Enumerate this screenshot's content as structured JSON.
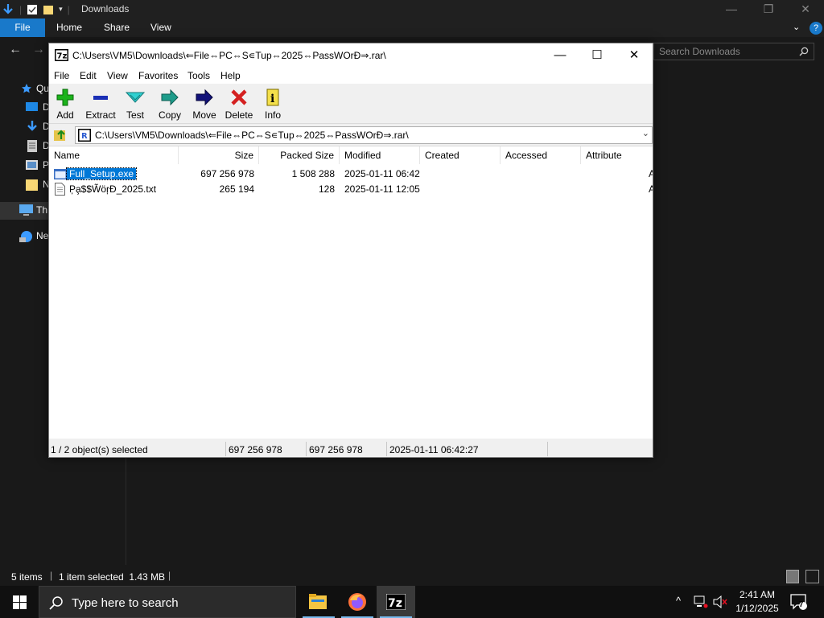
{
  "explorer": {
    "title": "Downloads",
    "tabs": {
      "file": "File",
      "home": "Home",
      "share": "Share",
      "view": "View"
    },
    "search_placeholder": "Search Downloads",
    "sidebar": [
      {
        "label": "Qu",
        "icon": "star-icon"
      },
      {
        "label": "D",
        "icon": "desktop-folder-icon"
      },
      {
        "label": "D",
        "icon": "downloads-folder-icon"
      },
      {
        "label": "D",
        "icon": "documents-folder-icon"
      },
      {
        "label": "P",
        "icon": "pictures-folder-icon"
      },
      {
        "label": "N",
        "icon": "folder-icon"
      },
      {
        "label": "Th",
        "icon": "this-pc-icon"
      },
      {
        "label": "Ne",
        "icon": "network-icon"
      }
    ],
    "status": {
      "items": "5 items",
      "selected": "1 item selected  1.43 MB"
    }
  },
  "zip": {
    "title": "C:\\Users\\VM5\\Downloads\\⇐File⇔PC⇔S∊Tup⇔2025⇔PassWOrÐ⇒.rar\\",
    "menu": [
      "File",
      "Edit",
      "View",
      "Favorites",
      "Tools",
      "Help"
    ],
    "toolbar": [
      {
        "label": "Add",
        "icon": "add-icon"
      },
      {
        "label": "Extract",
        "icon": "extract-icon"
      },
      {
        "label": "Test",
        "icon": "test-icon"
      },
      {
        "label": "Copy",
        "icon": "copy-icon"
      },
      {
        "label": "Move",
        "icon": "move-icon"
      },
      {
        "label": "Delete",
        "icon": "delete-icon"
      },
      {
        "label": "Info",
        "icon": "info-icon"
      }
    ],
    "address": "C:\\Users\\VM5\\Downloads\\⇐File⇔PC⇔S∊Tup⇔2025⇔PassWOrÐ⇒.rar\\",
    "columns": [
      "Name",
      "Size",
      "Packed Size",
      "Modified",
      "Created",
      "Accessed",
      "Attribute"
    ],
    "rows": [
      {
        "name": "Full_Setup.exe",
        "size": "697 256 978",
        "packed": "1 508 288",
        "modified": "2025-01-11 06:42",
        "created": "",
        "accessed": "",
        "attr": "A",
        "selected": true
      },
      {
        "name": "P̦a̧$$W̃ör̦Đ_2025.txt",
        "size": "265 194",
        "packed": "128",
        "modified": "2025-01-11 12:05",
        "created": "",
        "accessed": "",
        "attr": "A",
        "selected": false
      }
    ],
    "status": {
      "selection": "1 / 2 object(s) selected",
      "size": "697 256 978",
      "packed": "697 256 978",
      "modified": "2025-01-11 06:42:27"
    }
  },
  "taskbar": {
    "search_placeholder": "Type here to search",
    "time": "2:41 AM",
    "date": "1/12/2025",
    "notifications": "7"
  }
}
